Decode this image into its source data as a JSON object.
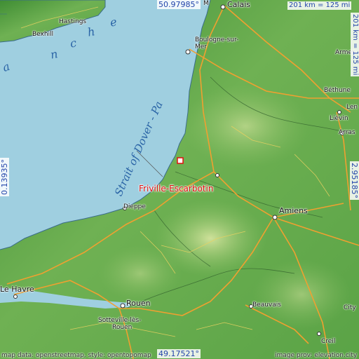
{
  "map": {
    "marker": {
      "label": "Friville-Escarbotin",
      "color": "#e01010"
    },
    "coords": {
      "top": "50.97985°",
      "bottom": "49.17521°",
      "left": "0.13935°",
      "right": "2.95185°"
    },
    "scale": {
      "top": "201 km = 125 mi",
      "right": "201 km = 125 mi"
    },
    "attribution": {
      "left": "map data: openstreetmap, style: opentopomap",
      "right": "image prov: elevation.city"
    },
    "sea_labels": {
      "channel_a": "a",
      "channel_n": "n",
      "channel_c": "c",
      "channel_h": "h",
      "channel_e": "e",
      "dover": "Strait of Dover - Pa"
    },
    "cities": {
      "calais": "Calais",
      "hastings": "Hastings",
      "bexhill": "Bexhill",
      "boulogne_1": "Boulogne-sur-",
      "boulogne_2": "Mer",
      "armentieres": "Armen",
      "bethune": "Béthune",
      "lens": "Len",
      "lievin": "Liévin",
      "arras": "Arras",
      "dieppe": "Dieppe",
      "amiens": "Amiens",
      "le_havre": "Le Havre",
      "rouen": "Rouen",
      "sotteville_1": "Sotteville-lès-",
      "sotteville_2": "Rouen",
      "beauvais": "Beauvais",
      "creil": "Creil",
      "city_e": "City",
      "m_top": "M"
    },
    "colors": {
      "sea": "#9fcfe0",
      "land_low": "#4f9d3c",
      "land_mid": "#8fc46a",
      "land_high": "#c9dd94",
      "road": "#f0a030",
      "coord_text": "#2244aa"
    }
  }
}
